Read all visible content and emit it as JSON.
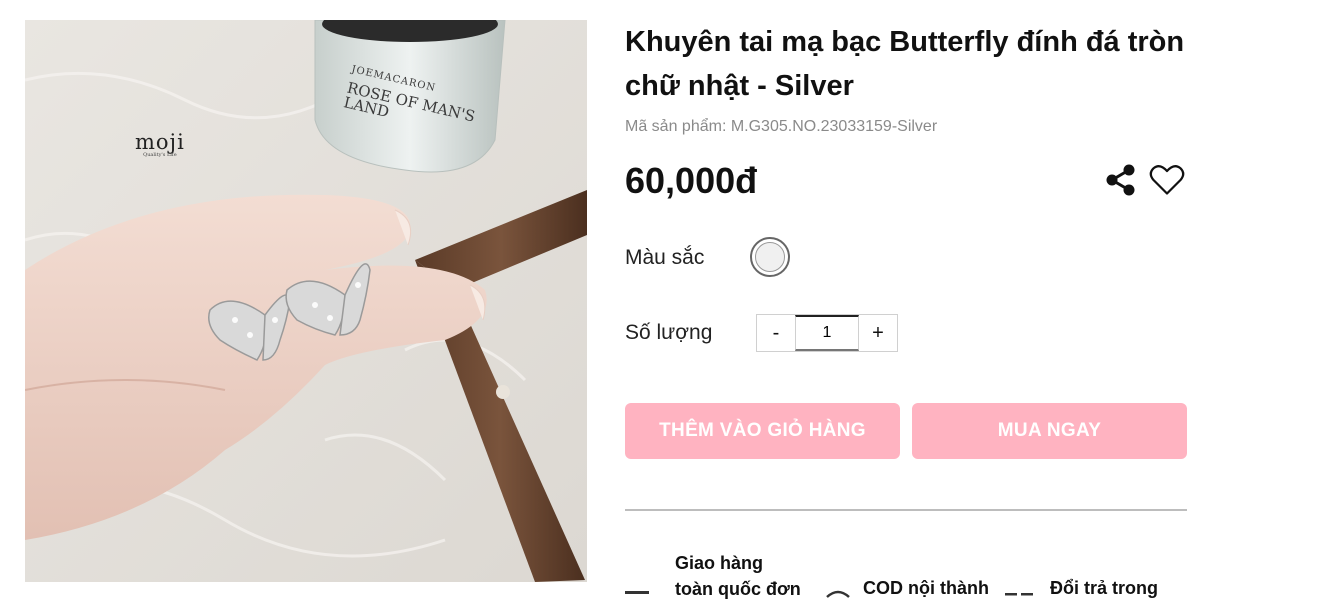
{
  "product": {
    "title": "Khuyên tai mạ bạc Butterfly đính đá tròn chữ nhật - Silver",
    "sku": "Mã sản phẩm: M.G305.NO.23033159-Silver",
    "price": "60,000đ"
  },
  "photo": {
    "brand_logo": "moji",
    "brand_sub": "Quality's Life",
    "bottle_brand": "JOEMACARON",
    "bottle_text": "ROSE OF MAN'S LAND"
  },
  "options": {
    "color_label": "Màu sắc",
    "color_value": "#f0f0f0",
    "quantity_label": "Số lượng",
    "quantity_value": "1",
    "minus": "-",
    "plus": "+"
  },
  "buttons": {
    "add_to_cart": "THÊM VÀO GIỎ HÀNG",
    "buy_now": "MUA NGAY",
    "color": "#ffb3c1"
  },
  "icons": {
    "share": "share-icon",
    "wishlist": "heart-icon"
  },
  "perks": {
    "shipping_line1": "Giao hàng",
    "shipping_line2": "toàn quốc đơn",
    "cod": "COD nội thành",
    "returns": "Đổi trả trong"
  }
}
